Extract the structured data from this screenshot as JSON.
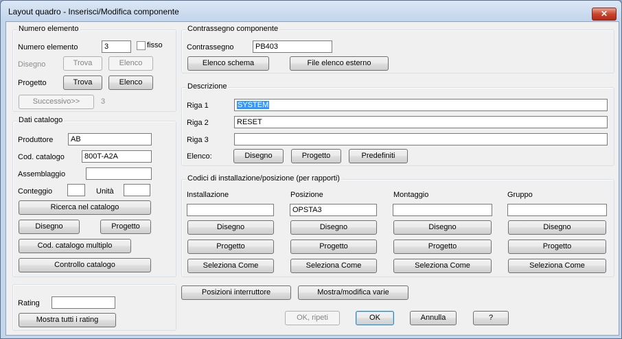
{
  "window": {
    "title": "Layout quadro - Inserisci/Modifica componente",
    "close_glyph": "✕"
  },
  "numero": {
    "group_label": "Numero elemento",
    "label": "Numero elemento",
    "value": "3",
    "fisso_label": "fisso",
    "disegno_label": "Disegno",
    "disegno_trova": "Trova",
    "disegno_elenco": "Elenco",
    "progetto_label": "Progetto",
    "progetto_trova": "Trova",
    "progetto_elenco": "Elenco",
    "successivo": "Successivo>>",
    "successivo_value": "3"
  },
  "catalogo": {
    "group_label": "Dati catalogo",
    "produttore_label": "Produttore",
    "produttore_value": "AB",
    "cod_label": "Cod. catalogo",
    "cod_value": "800T-A2A",
    "assemblaggio_label": "Assemblaggio",
    "assemblaggio_value": "",
    "conteggio_label": "Conteggio",
    "conteggio_value": "",
    "unita_label": "Unità",
    "unita_value": "",
    "ricerca": "Ricerca nel catalogo",
    "disegno": "Disegno",
    "progetto": "Progetto",
    "multiplo": "Cod. catalogo multiplo",
    "controllo": "Controllo catalogo"
  },
  "rating": {
    "label": "Rating",
    "value": "",
    "mostra": "Mostra tutti i rating"
  },
  "contrassegno": {
    "group_label": "Contrassegno componente",
    "label": "Contrassegno",
    "value": "PB403",
    "elenco_schema": "Elenco schema",
    "file_esterno": "File elenco esterno"
  },
  "descrizione": {
    "group_label": "Descrizione",
    "riga1_label": "Riga 1",
    "riga1_value": "SYSTEM",
    "riga2_label": "Riga 2",
    "riga2_value": "RESET",
    "riga3_label": "Riga 3",
    "riga3_value": "",
    "elenco_label": "Elenco:",
    "disegno": "Disegno",
    "progetto": "Progetto",
    "predefiniti": "Predefiniti"
  },
  "codici": {
    "group_label": "Codici di installazione/posizione (per rapporti)",
    "columns": [
      {
        "label": "Installazione",
        "value": "",
        "disegno": "Disegno",
        "progetto": "Progetto",
        "seleziona": "Seleziona Come"
      },
      {
        "label": "Posizione",
        "value": "OPSTA3",
        "disegno": "Disegno",
        "progetto": "Progetto",
        "seleziona": "Seleziona Come"
      },
      {
        "label": "Montaggio",
        "value": "",
        "disegno": "Disegno",
        "progetto": "Progetto",
        "seleziona": "Seleziona Come"
      },
      {
        "label": "Gruppo",
        "value": "",
        "disegno": "Disegno",
        "progetto": "Progetto",
        "seleziona": "Seleziona Come"
      }
    ]
  },
  "bottom": {
    "posizioni": "Posizioni interruttore",
    "mostra_varie": "Mostra/modifica varie",
    "ok_ripeti": "OK, ripeti",
    "ok": "OK",
    "annulla": "Annulla",
    "help": "?"
  }
}
